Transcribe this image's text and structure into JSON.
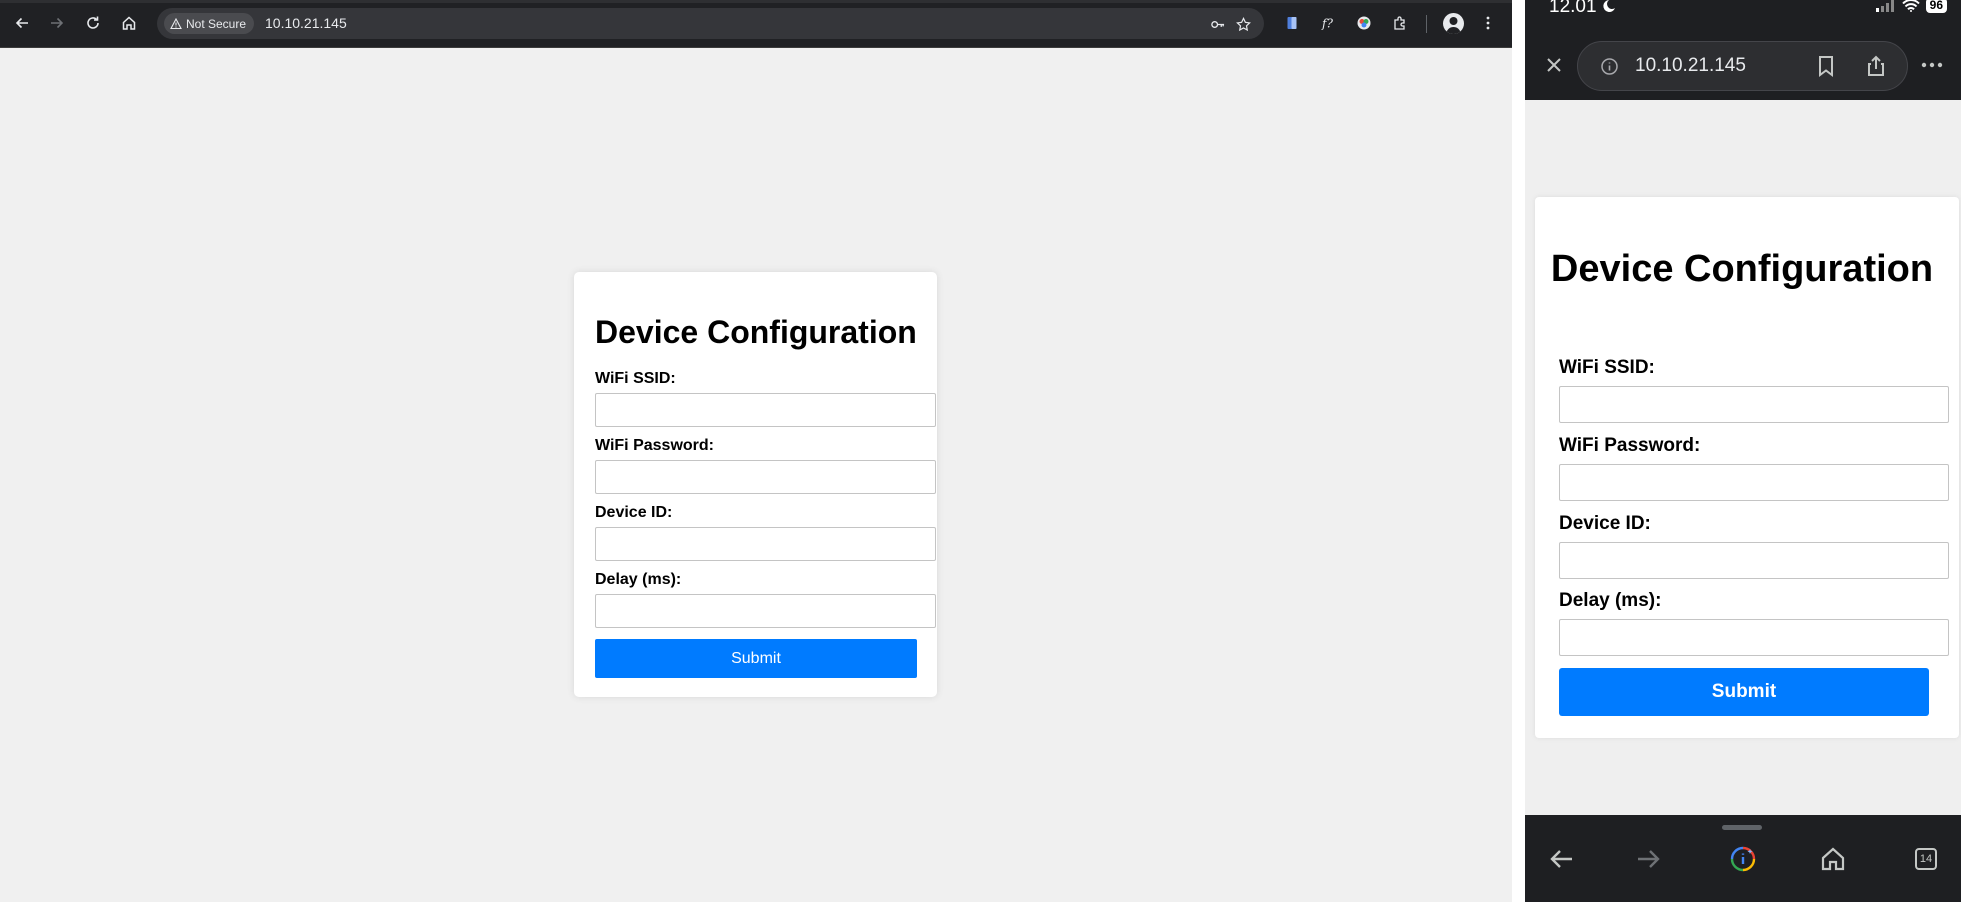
{
  "desktop": {
    "toolbar": {
      "security_chip": "Not Secure",
      "url": "10.10.21.145",
      "icons": [
        "back-icon",
        "forward-icon",
        "reload-icon",
        "home-icon",
        "key-icon",
        "star-icon",
        "extension-doc-icon",
        "extension-function-icon",
        "extension-color-icon",
        "extensions-puzzle-icon",
        "profile-avatar",
        "menu-kebab-icon"
      ]
    },
    "form": {
      "title": "Device Configuration",
      "ssid_label": "WiFi SSID:",
      "password_label": "WiFi Password:",
      "device_id_label": "Device ID:",
      "delay_label": "Delay (ms):",
      "ssid_value": "",
      "password_value": "",
      "device_id_value": "",
      "delay_value": "",
      "submit_label": "Submit"
    }
  },
  "mobile": {
    "status": {
      "time": "12.01",
      "battery": "96"
    },
    "toolbar": {
      "url": "10.10.21.145"
    },
    "form": {
      "title": "Device Configuration",
      "ssid_label": "WiFi SSID:",
      "password_label": "WiFi Password:",
      "device_id_label": "Device ID:",
      "delay_label": "Delay (ms):",
      "submit_label": "Submit"
    },
    "bottom_bar": {
      "tab_count": "14"
    }
  },
  "colors": {
    "primary_button": "#007bff",
    "page_background": "#f0f0f0",
    "browser_chrome": "#202124"
  }
}
